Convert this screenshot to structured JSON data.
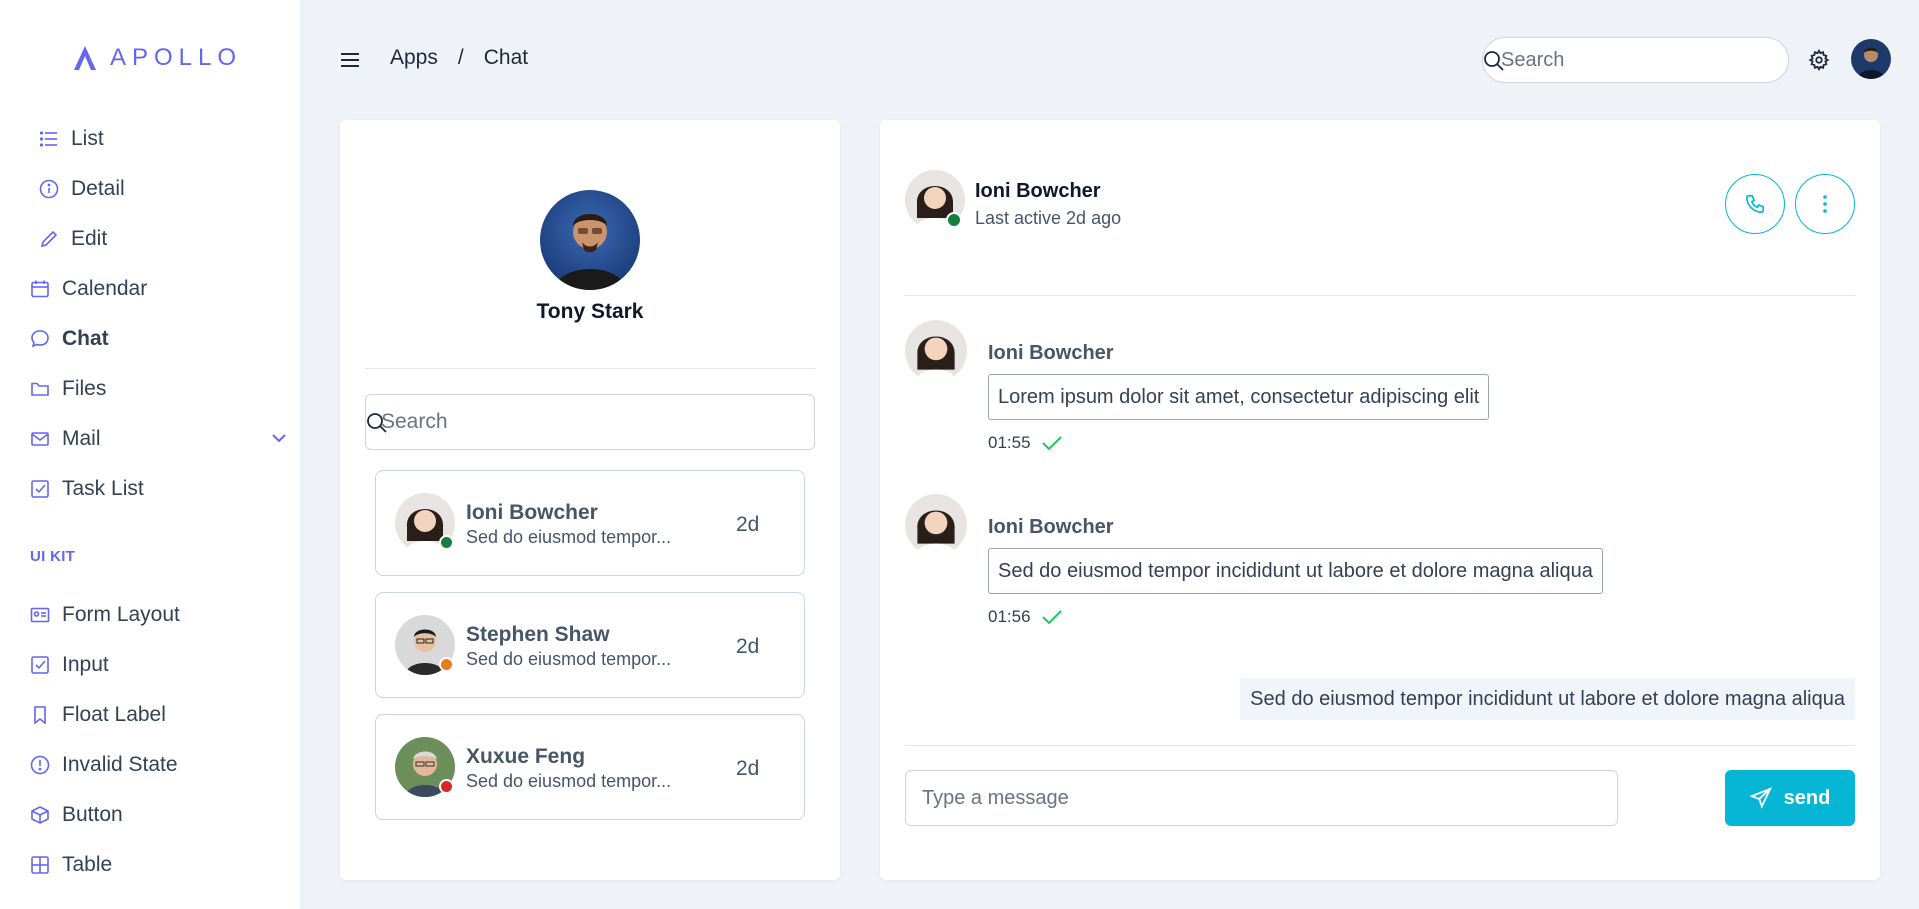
{
  "brand": {
    "name": "APOLLO",
    "accent": "#6366f1",
    "primary": "#06b6d4"
  },
  "sidebar": {
    "items": [
      {
        "label": "List",
        "icon": "list-icon"
      },
      {
        "label": "Detail",
        "icon": "info-circle-icon"
      },
      {
        "label": "Edit",
        "icon": "pencil-icon"
      },
      {
        "label": "Calendar",
        "icon": "calendar-icon"
      },
      {
        "label": "Chat",
        "icon": "chat-icon",
        "active": true
      },
      {
        "label": "Files",
        "icon": "folder-icon"
      },
      {
        "label": "Mail",
        "icon": "mail-icon",
        "expandable": true
      },
      {
        "label": "Task List",
        "icon": "check-square-icon"
      }
    ],
    "section_label": "UI KIT",
    "ui_items": [
      {
        "label": "Form Layout",
        "icon": "id-card-icon"
      },
      {
        "label": "Input",
        "icon": "check-square-icon"
      },
      {
        "label": "Float Label",
        "icon": "bookmark-icon"
      },
      {
        "label": "Invalid State",
        "icon": "exclamation-circle-icon"
      },
      {
        "label": "Button",
        "icon": "box-icon"
      },
      {
        "label": "Table",
        "icon": "table-icon"
      }
    ]
  },
  "topbar": {
    "breadcrumb": [
      "Apps",
      "Chat"
    ],
    "breadcrumb_separator": "/",
    "search_placeholder": "Search"
  },
  "profile": {
    "name": "Tony Stark"
  },
  "contacts": {
    "search_placeholder": "Search",
    "items": [
      {
        "name": "Ioni Bowcher",
        "preview": "Sed do eiusmod tempor...",
        "time": "2d",
        "status_color": "#15803d"
      },
      {
        "name": "Stephen Shaw",
        "preview": "Sed do eiusmod tempor...",
        "time": "2d",
        "status_color": "#ea7a1e"
      },
      {
        "name": "Xuxue Feng",
        "preview": "Sed do eiusmod tempor...",
        "time": "2d",
        "status_color": "#dc2626"
      }
    ]
  },
  "chat": {
    "name": "Ioni Bowcher",
    "last_active": "Last active 2d ago",
    "messages": [
      {
        "sender": "Ioni Bowcher",
        "text": "Lorem ipsum dolor sit amet, consectetur adipiscing elit",
        "time": "01:55"
      },
      {
        "sender": "Ioni Bowcher",
        "text": "Sed do eiusmod tempor incididunt ut labore et dolore magna aliqua",
        "time": "01:56"
      }
    ],
    "own_message": "Sed do eiusmod tempor incididunt ut labore et dolore magna aliqua",
    "input_placeholder": "Type a message",
    "send_label": "send"
  }
}
